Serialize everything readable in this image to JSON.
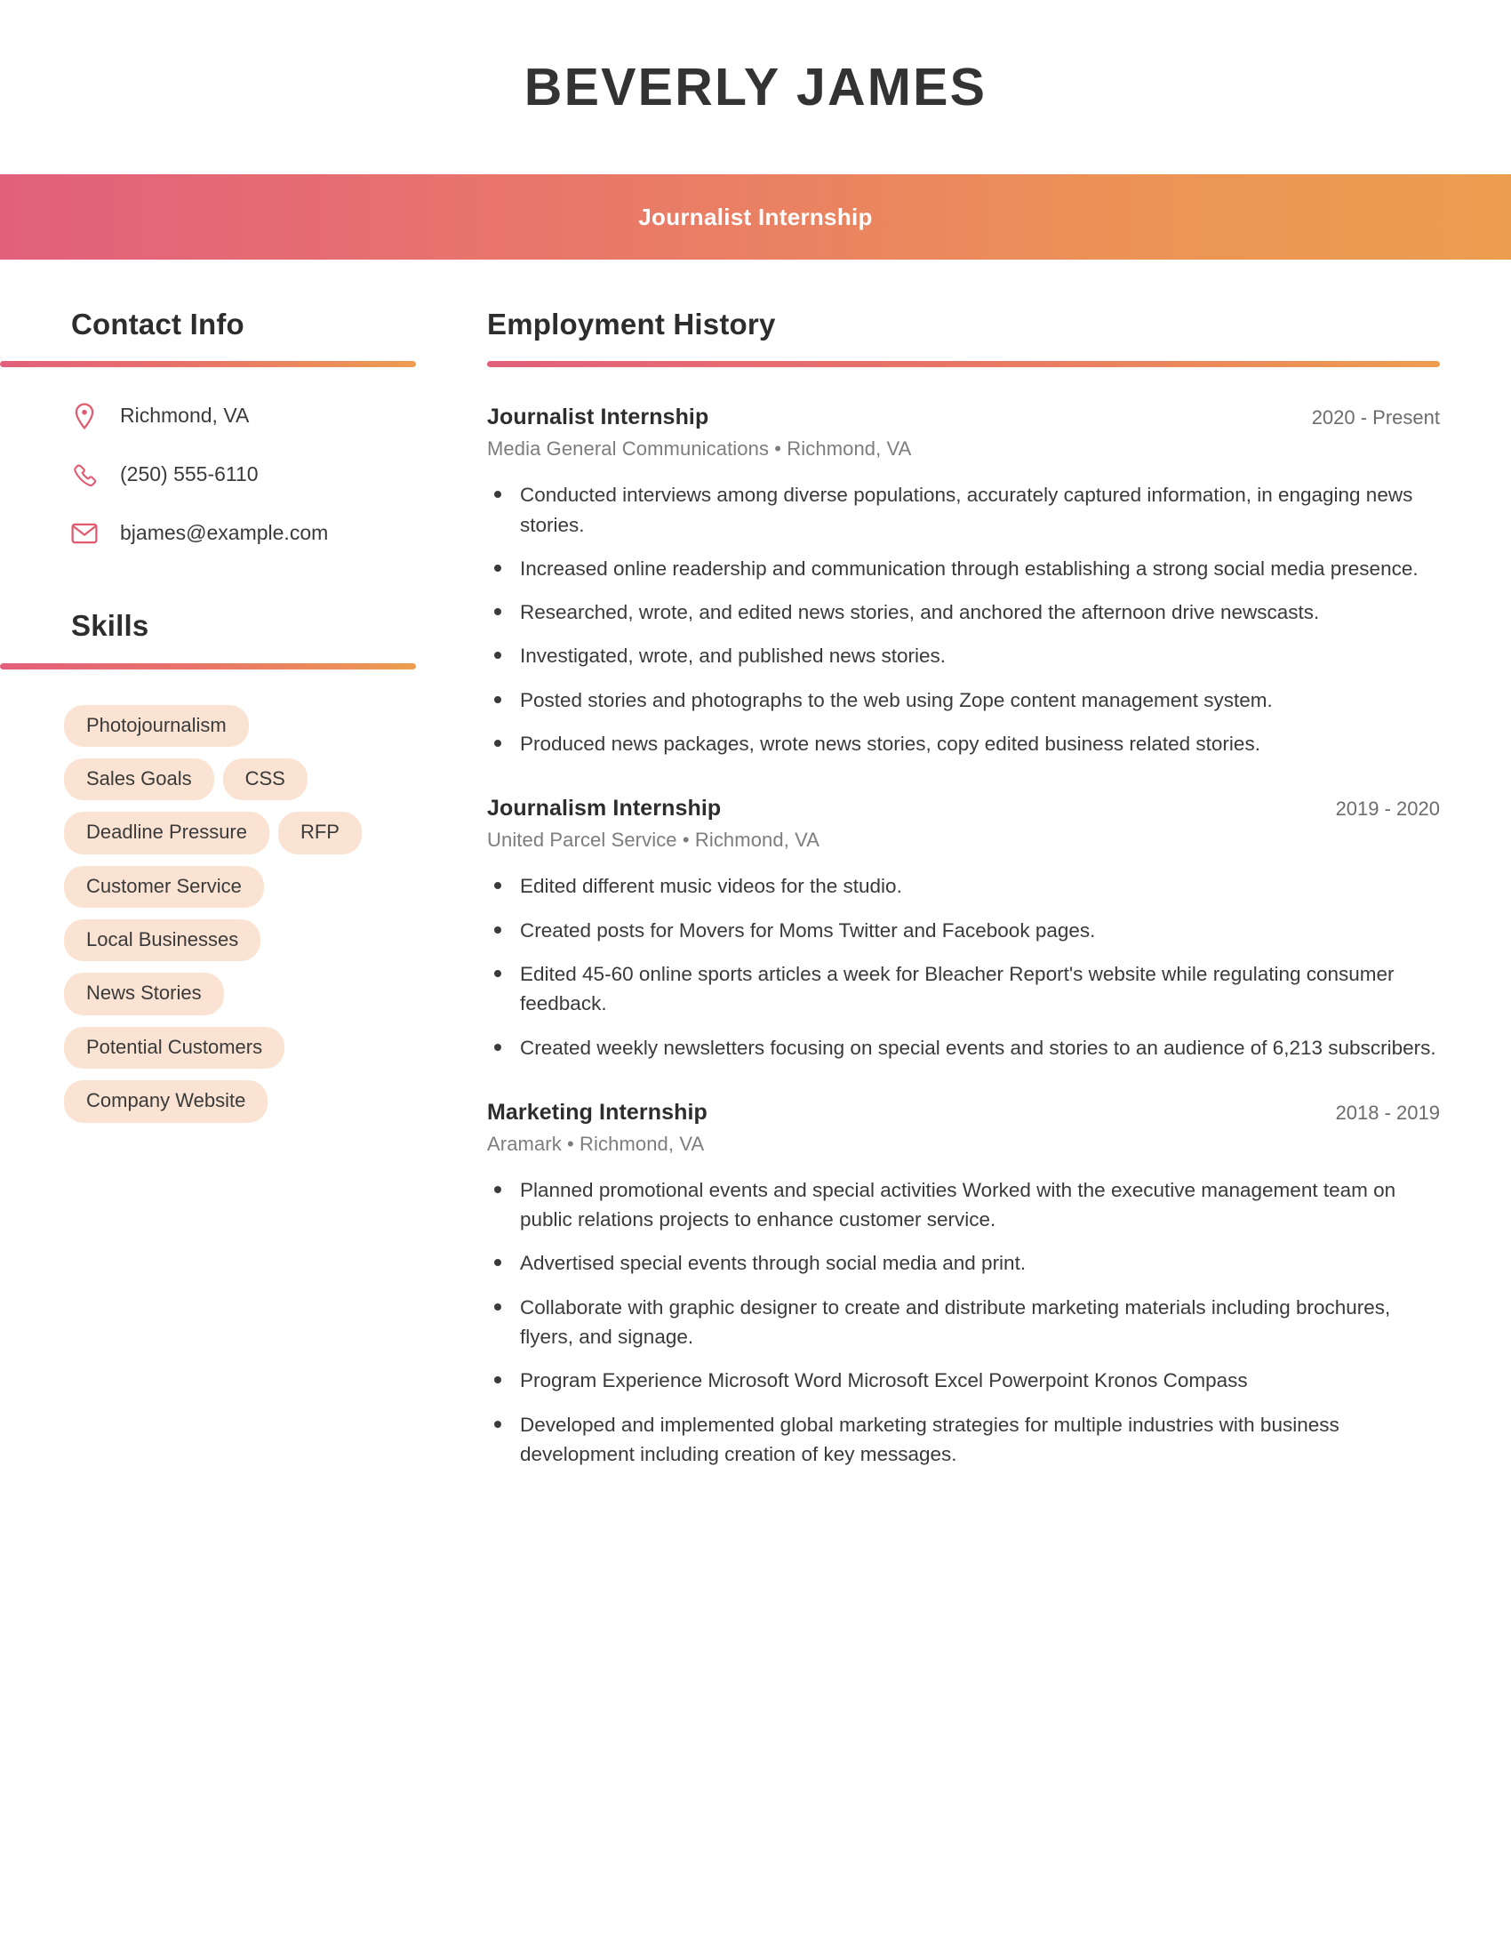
{
  "theme": {
    "gradient_start": "#e2607c",
    "gradient_end": "#ed9d50",
    "accent_pink": "#e2607c",
    "accent_orange": "#ed9d50",
    "skill_pill_bg": "#fae3d2",
    "heading_color": "#2d2d2d",
    "body_text_color": "#3a3a3a",
    "muted_text_color": "#7d7d7d"
  },
  "header": {
    "name": "BEVERLY JAMES",
    "job_title": "Journalist Internship"
  },
  "sidebar": {
    "contact": {
      "heading": "Contact Info",
      "items": [
        {
          "icon": "location-pin-icon",
          "value": "Richmond, VA"
        },
        {
          "icon": "phone-icon",
          "value": "(250) 555-6110"
        },
        {
          "icon": "envelope-icon",
          "value": "bjames@example.com"
        }
      ]
    },
    "skills": {
      "heading": "Skills",
      "items": [
        "Photojournalism",
        "Sales Goals",
        "CSS",
        "Deadline Pressure",
        "RFP",
        "Customer Service",
        "Local Businesses",
        "News Stories",
        "Potential Customers",
        "Company Website"
      ]
    }
  },
  "main": {
    "employment": {
      "heading": "Employment History",
      "jobs": [
        {
          "title": "Journalist Internship",
          "dates": "2020 - Present",
          "company": "Media General Communications",
          "location": "Richmond, VA",
          "meta": "Media General Communications  •  Richmond, VA",
          "bullets": [
            "Conducted interviews among diverse populations, accurately captured information, in engaging news stories.",
            "Increased online readership and communication through establishing a strong social media presence.",
            "Researched, wrote, and edited news stories, and anchored the afternoon drive newscasts.",
            "Investigated, wrote, and published news stories.",
            "Posted stories and photographs to the web using Zope content management system.",
            "Produced news packages, wrote news stories, copy edited business related stories."
          ]
        },
        {
          "title": "Journalism Internship",
          "dates": "2019 - 2020",
          "company": "United Parcel Service",
          "location": "Richmond, VA",
          "meta": "United Parcel Service  •  Richmond, VA",
          "bullets": [
            "Edited different music videos for the studio.",
            "Created posts for Movers for Moms Twitter and Facebook pages.",
            "Edited 45-60 online sports articles a week for Bleacher Report's website while regulating consumer feedback.",
            "Created weekly newsletters focusing on special events and stories to an audience of 6,213 subscribers."
          ]
        },
        {
          "title": "Marketing Internship",
          "dates": "2018 - 2019",
          "company": "Aramark",
          "location": "Richmond, VA",
          "meta": "Aramark  •  Richmond, VA",
          "bullets": [
            "Planned promotional events and special activities Worked with the executive management team on public relations projects to enhance customer service.",
            "Advertised special events through social media and print.",
            "Collaborate with graphic designer to create and distribute marketing materials including brochures, flyers, and signage.",
            "Program Experience Microsoft Word Microsoft Excel Powerpoint Kronos Compass",
            "Developed and implemented global marketing strategies for multiple industries with business development including creation of key messages."
          ]
        }
      ]
    }
  }
}
